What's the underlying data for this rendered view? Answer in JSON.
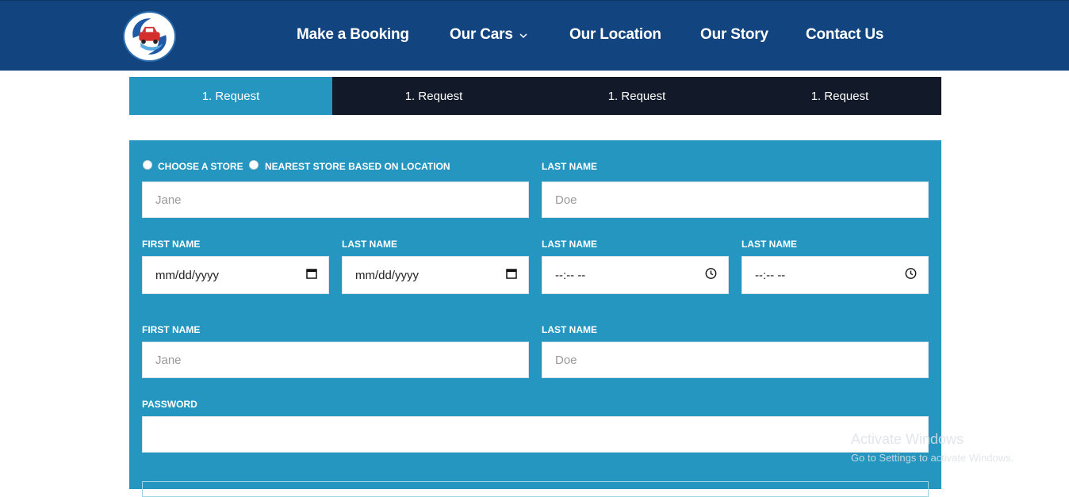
{
  "nav": {
    "items": [
      {
        "label": "Make a Booking"
      },
      {
        "label": "Our Cars"
      },
      {
        "label": "Our Location"
      },
      {
        "label": "Our Story"
      },
      {
        "label": "Contact Us"
      }
    ]
  },
  "steps": [
    "1. Request",
    "1. Request",
    "1. Request",
    "1. Request"
  ],
  "form": {
    "radio_choose": "CHOOSE A STORE",
    "radio_nearest": "NEAREST STORE BASED ON LOCATION",
    "row1": {
      "right_label": "LAST NAME",
      "left_placeholder": "Jane",
      "right_placeholder": "Doe"
    },
    "row2": {
      "labels": [
        "FIRST NAME",
        "LAST NAME",
        "LAST NAME",
        "LAST NAME"
      ],
      "date_placeholder": "mm/dd/yyyy",
      "time_placeholder": "--:-- --"
    },
    "row3": {
      "left_label": "FIRST NAME",
      "right_label": "LAST NAME",
      "left_placeholder": "Jane",
      "right_placeholder": "Doe"
    },
    "password_label": "PASSWORD"
  },
  "watermark": {
    "title": "Activate Windows",
    "subtitle": "Go to Settings to activate Windows."
  },
  "colors": {
    "nav_bg": "#12457f",
    "step_active": "#2596c0",
    "step_inactive": "#121a2a",
    "form_bg": "#2596c0"
  },
  "icons": [
    "car-logo-icon",
    "chevron-down-icon",
    "calendar-icon",
    "clock-icon"
  ]
}
